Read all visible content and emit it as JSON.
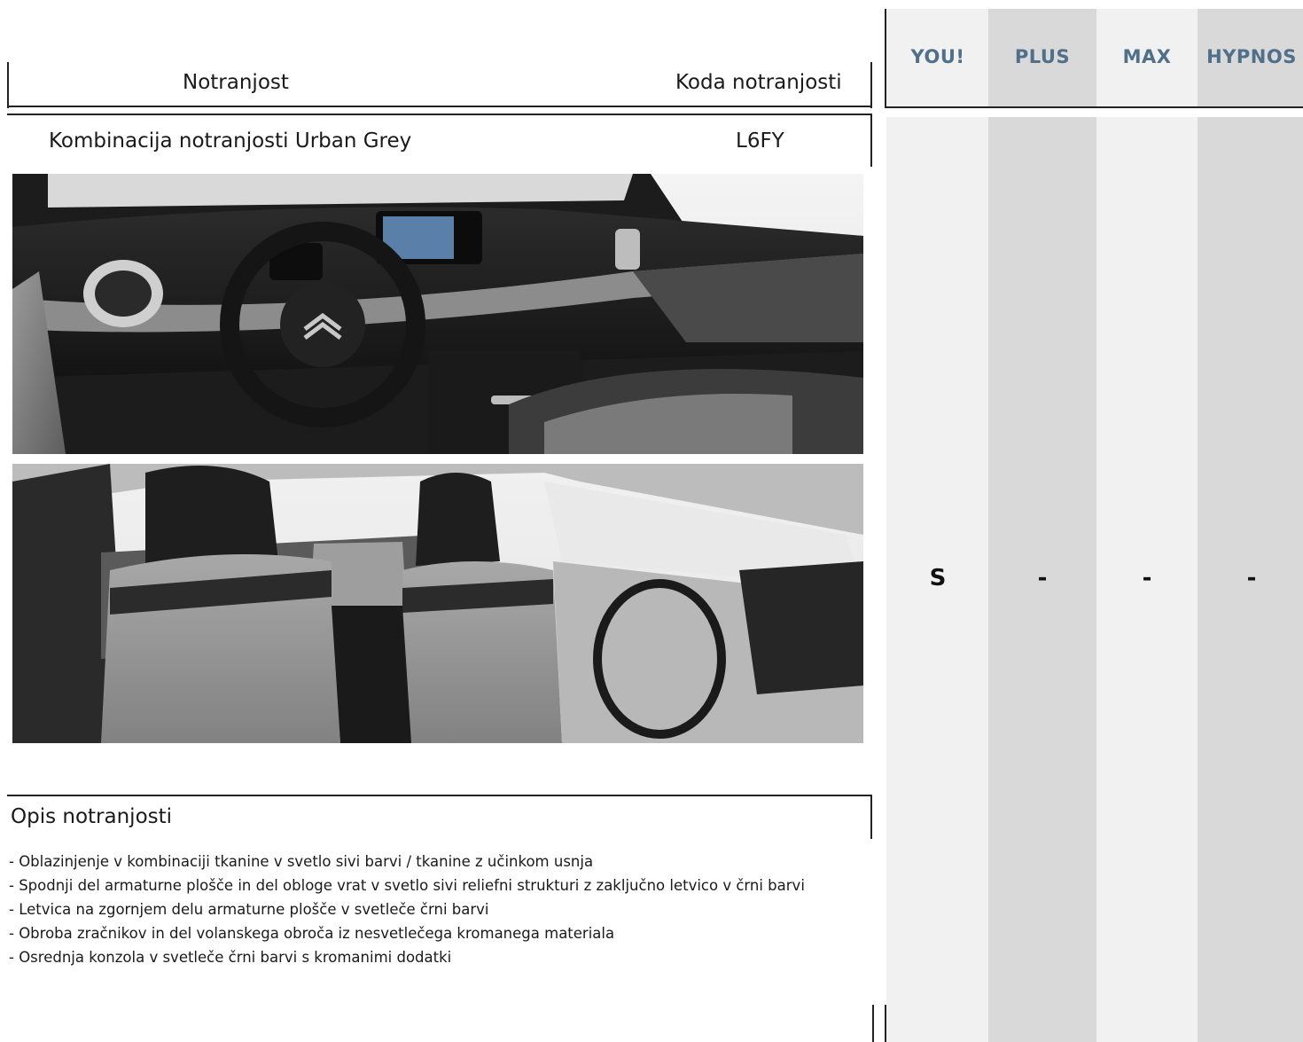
{
  "header": {
    "col_interior": "Notranjost",
    "col_code": "Koda notranjosti"
  },
  "trims": [
    "YOU!",
    "PLUS",
    "MAX",
    "HYPNOS"
  ],
  "interior_row": {
    "name": "Kombinacija notranjosti Urban Grey",
    "code": "L6FY",
    "availability": [
      "S",
      "-",
      "-",
      "-"
    ]
  },
  "description": {
    "title": "Opis notranjosti",
    "items": [
      "- Oblazinjenje v kombinaciji tkanine v svetlo sivi barvi / tkanine z učinkom usnja",
      "- Spodnji del armaturne plošče in del obloge vrat v svetlo sivi reliefni strukturi z zaključno letvico v črni barvi",
      "- Letvica na zgornjem delu armaturne plošče v svetleče črni barvi",
      "- Obroba zračnikov in del volanskega obroča iz nesvetlečega kromanega materiala",
      "- Osrednja konzola v svetleče črni barvi s kromanimi dodatki"
    ]
  },
  "colors": {
    "trim_label": "#4f6f8a",
    "column_light": "#f1f1f1",
    "column_dark": "#d9d9d9"
  }
}
